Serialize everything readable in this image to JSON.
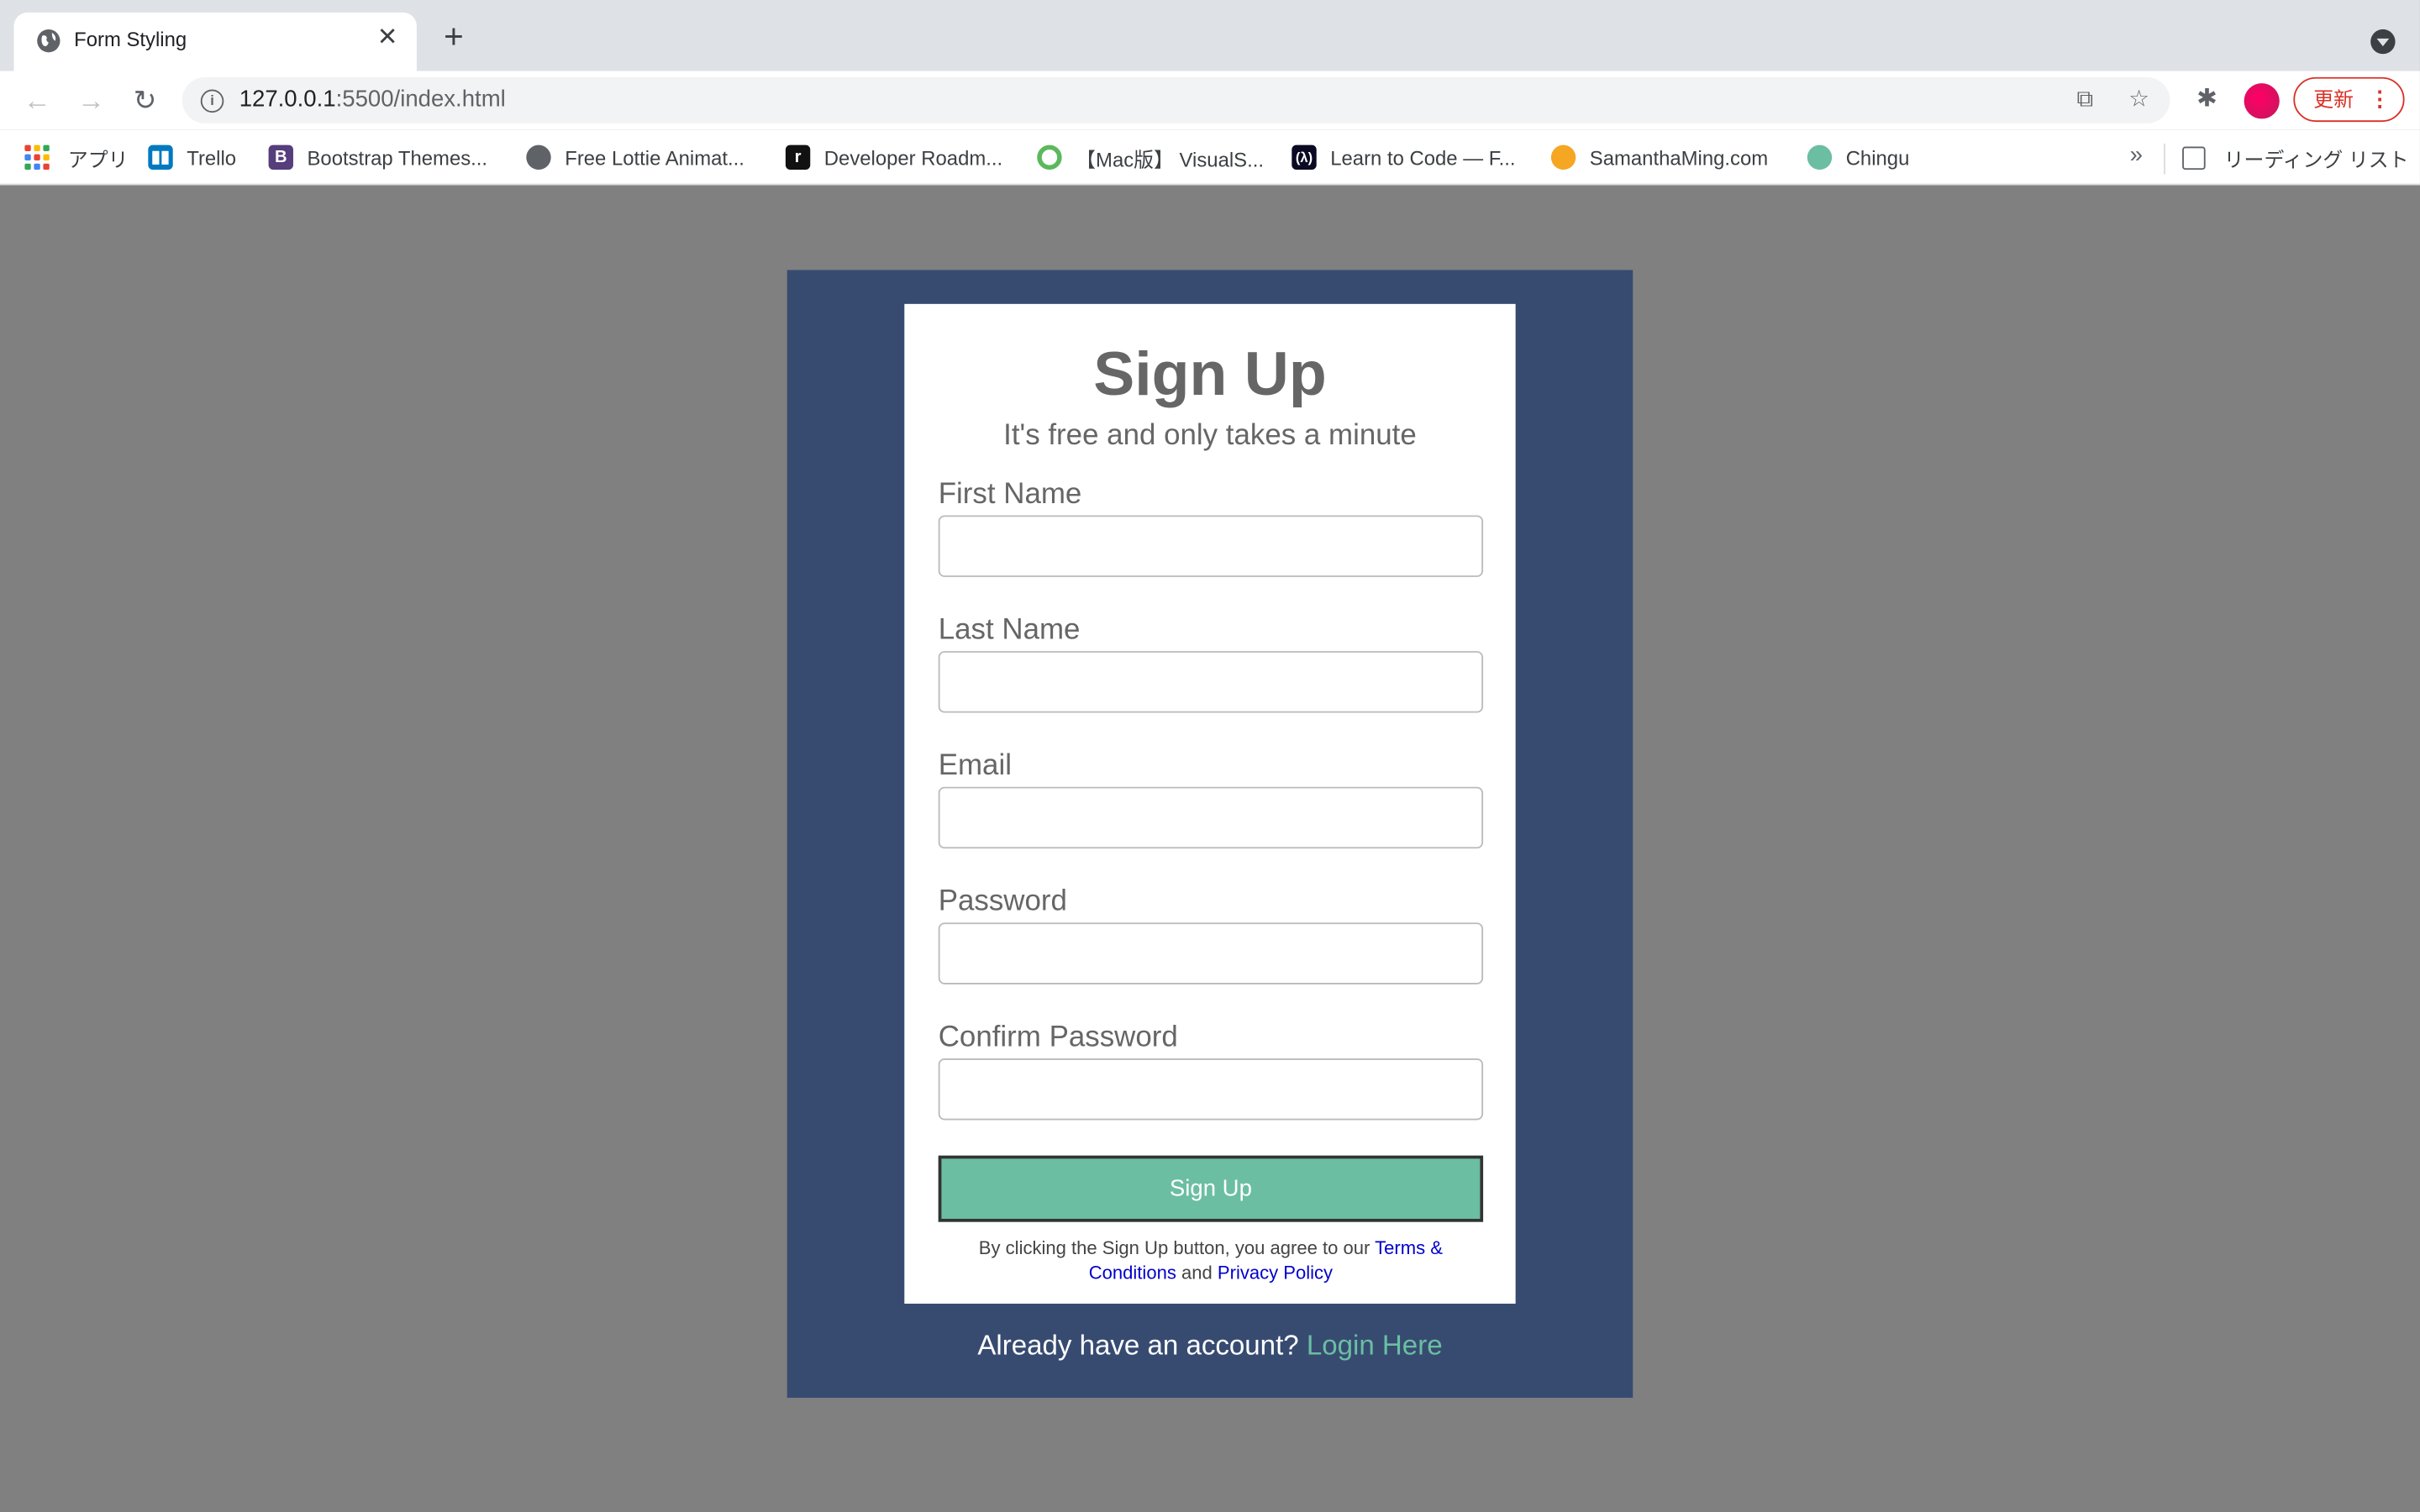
{
  "browser": {
    "tab_title": "Form Styling",
    "new_tab_symbol": "+",
    "url_host": "127.0.0.1",
    "url_rest": ":5500/index.html",
    "update_label": "更新"
  },
  "bookmarks": {
    "items": [
      {
        "label": "アプリ",
        "icon": "apps-icon"
      },
      {
        "label": "Trello",
        "icon": "trello-icon",
        "color": "#0079bf"
      },
      {
        "label": "Bootstrap Themes...",
        "icon": "bootstrap-icon",
        "color": "#563d7c"
      },
      {
        "label": "Free Lottie Animat...",
        "icon": "globe-icon"
      },
      {
        "label": "Developer Roadm...",
        "icon": "roadmap-icon",
        "color": "#111111"
      },
      {
        "label": "【Mac版】 VisualS...",
        "icon": "visualstudio-icon",
        "color": "#5cb85c"
      },
      {
        "label": "Learn to Code — F...",
        "icon": "freecodecamp-icon",
        "color": "#0a0a23"
      },
      {
        "label": "SamanthaMing.com",
        "icon": "samantha-icon",
        "color": "#f5a623"
      },
      {
        "label": "Chingu",
        "icon": "chingu-icon",
        "color": "#6bbea2"
      }
    ],
    "more_symbol": "»",
    "reading_list": "リーディング リスト"
  },
  "form": {
    "title": "Sign Up",
    "subtitle": "It's free and only takes a minute",
    "fields": [
      {
        "label": "First Name",
        "value": ""
      },
      {
        "label": "Last Name",
        "value": ""
      },
      {
        "label": "Email",
        "value": ""
      },
      {
        "label": "Password",
        "value": ""
      },
      {
        "label": "Confirm Password",
        "value": ""
      }
    ],
    "submit_label": "Sign Up",
    "terms_prefix": "By clicking the Sign Up button, you agree to our ",
    "terms_link": "Terms & Conditions",
    "terms_and": " and ",
    "privacy_link": "Privacy Policy",
    "login_prompt": "Already have an account? ",
    "login_link": "Login Here"
  },
  "colors": {
    "page_bg": "#808080",
    "panel_bg": "#374b71",
    "accent": "#6bbea2",
    "link": "#0000cc"
  }
}
